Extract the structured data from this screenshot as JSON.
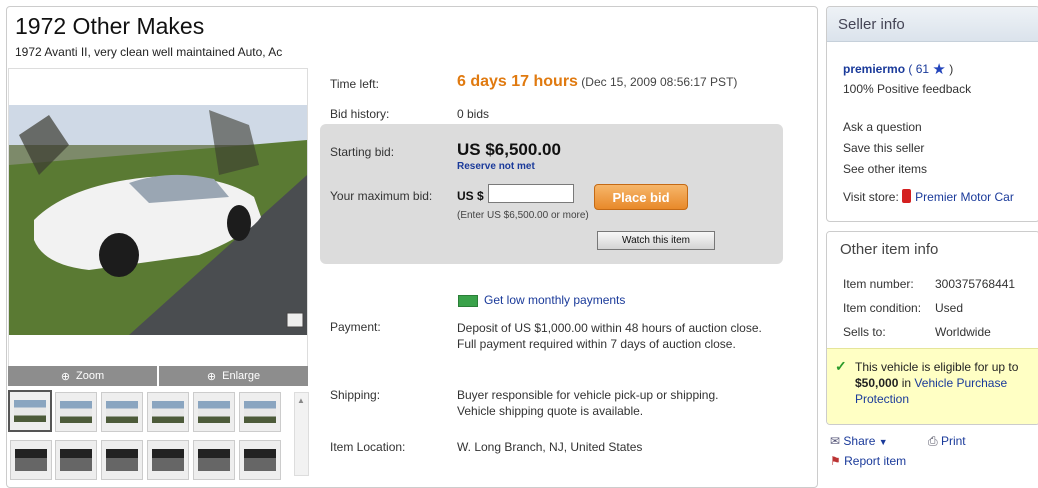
{
  "listing": {
    "title": "1972 Other Makes",
    "subtitle": "1972 Avanti II, very clean well maintained Auto, Ac"
  },
  "photo": {
    "zoom_label": "Zoom",
    "enlarge_label": "Enlarge",
    "thumb_count_visible": 12
  },
  "details": {
    "time_left_label": "Time left:",
    "time_left_value": "6 days 17 hours",
    "time_left_end": "(Dec 15, 2009 08:56:17 PST)",
    "bid_history_label": "Bid history:",
    "bid_history_value": "0 bids",
    "starting_bid_label": "Starting bid:",
    "starting_bid_value": "US $6,500.00",
    "reserve_status": "Reserve not met",
    "max_bid_label": "Your maximum bid:",
    "currency_prefix": "US $",
    "max_bid_value": "",
    "enter_note": "(Enter US $6,500.00 or more)",
    "place_bid_label": "Place bid",
    "watch_label": "Watch this item",
    "monthly_payments_link": "Get low monthly payments",
    "payment_label": "Payment:",
    "payment_value": "Deposit of US $1,000.00 within 48 hours of auction close. Full payment required within 7 days of auction close.",
    "shipping_label": "Shipping:",
    "shipping_value": "Buyer responsible for vehicle pick-up or shipping.",
    "shipping_link": "Vehicle shipping quote is available.",
    "location_label": "Item Location:",
    "location_value": "W. Long Branch, NJ, United States"
  },
  "seller": {
    "header": "Seller info",
    "name": "premiermo",
    "feedback_open": "( 61",
    "feedback_close": ")",
    "positive": "100% Positive feedback",
    "ask_question": "Ask a question",
    "save_seller": "Save this seller",
    "see_other": "See other items",
    "visit_store_label": "Visit store:",
    "store_name": "Premier Motor Car"
  },
  "other_info": {
    "header": "Other item info",
    "item_number_label": "Item number:",
    "item_number_value": "300375768441",
    "condition_label": "Item condition:",
    "condition_value": "Used",
    "sells_to_label": "Sells to:",
    "sells_to_value": "Worldwide",
    "eligible_text_1": "This vehicle is eligible for up to",
    "eligible_amount": "$50,000",
    "eligible_text_2": "in",
    "eligible_link": "Vehicle Purchase Protection"
  },
  "actions": {
    "share": "Share",
    "print": "Print",
    "report": "Report item"
  },
  "colors": {
    "time_left": "#e07a10",
    "link": "#1a3a9a",
    "place_bid": "#e8892a",
    "eligible_bg": "#ffffc4"
  }
}
